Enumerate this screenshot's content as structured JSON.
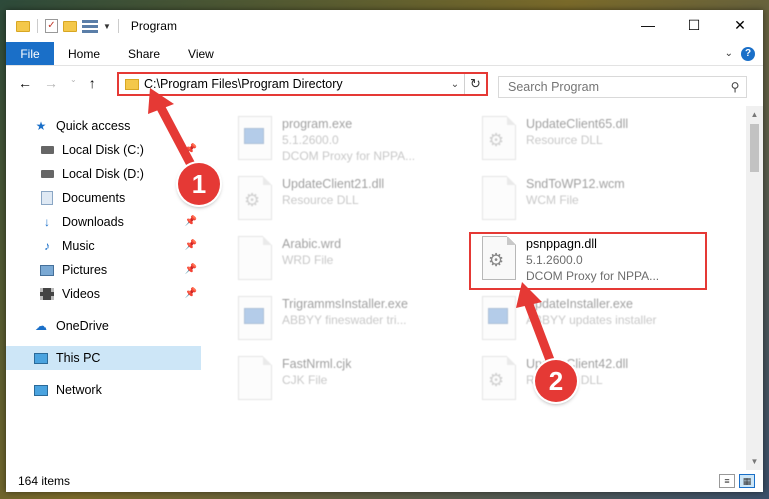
{
  "window": {
    "title": "Program"
  },
  "ribbon": {
    "file": "File",
    "tabs": [
      "Home",
      "Share",
      "View"
    ],
    "help": "?"
  },
  "address": {
    "path": "C:\\Program Files\\Program Directory"
  },
  "search": {
    "placeholder": "Search Program"
  },
  "sidebar": {
    "items": [
      {
        "label": "Quick access",
        "icon": "star-icon"
      },
      {
        "label": "Local Disk (C:)",
        "icon": "drive-icon",
        "pinned": true
      },
      {
        "label": "Local Disk (D:)",
        "icon": "drive-icon"
      },
      {
        "label": "Documents",
        "icon": "documents-icon"
      },
      {
        "label": "Downloads",
        "icon": "download-arrow-icon",
        "pinned": true
      },
      {
        "label": "Music",
        "icon": "music-note-icon",
        "pinned": true
      },
      {
        "label": "Pictures",
        "icon": "picture-icon",
        "pinned": true
      },
      {
        "label": "Videos",
        "icon": "film-icon",
        "pinned": true
      },
      {
        "label": "OneDrive",
        "icon": "cloud-icon"
      },
      {
        "label": "This PC",
        "icon": "computer-icon",
        "selected": true
      },
      {
        "label": "Network",
        "icon": "network-icon"
      }
    ]
  },
  "files": [
    {
      "name": "program.exe",
      "line2": "5.1.2600.0",
      "line3": "DCOM Proxy for NPPA...",
      "icon": "exe-icon"
    },
    {
      "name": "UpdateClient65.dll",
      "line2": "Resource DLL",
      "line3": "",
      "icon": "dll-gear-icon"
    },
    {
      "name": "UpdateClient21.dll",
      "line2": "Resource DLL",
      "line3": "",
      "icon": "dll-gear-icon"
    },
    {
      "name": "SndToWP12.wcm",
      "line2": "WCM File",
      "line3": "",
      "icon": "file-icon"
    },
    {
      "name": "Arabic.wrd",
      "line2": "WRD File",
      "line3": "",
      "icon": "file-icon"
    },
    {
      "name": "psnppagn.dll",
      "line2": "5.1.2600.0",
      "line3": "DCOM Proxy for NPPA...",
      "icon": "dll-gear-icon"
    },
    {
      "name": "TrigrammsInstaller.exe",
      "line2": "ABBYY fineswader tri...",
      "line3": "",
      "icon": "exe-icon"
    },
    {
      "name": "UpdateInstaller.exe",
      "line2": "ABBYY updates installer",
      "line3": "",
      "icon": "exe-icon"
    },
    {
      "name": "FastNrml.cjk",
      "line2": "CJK File",
      "line3": "",
      "icon": "file-icon"
    },
    {
      "name": "UpdateClient42.dll",
      "line2": "Resource DLL",
      "line3": "",
      "icon": "dll-gear-icon"
    }
  ],
  "status": {
    "count": "164 items"
  },
  "annotations": {
    "step1": "1",
    "step2": "2",
    "color": "#e53935"
  }
}
